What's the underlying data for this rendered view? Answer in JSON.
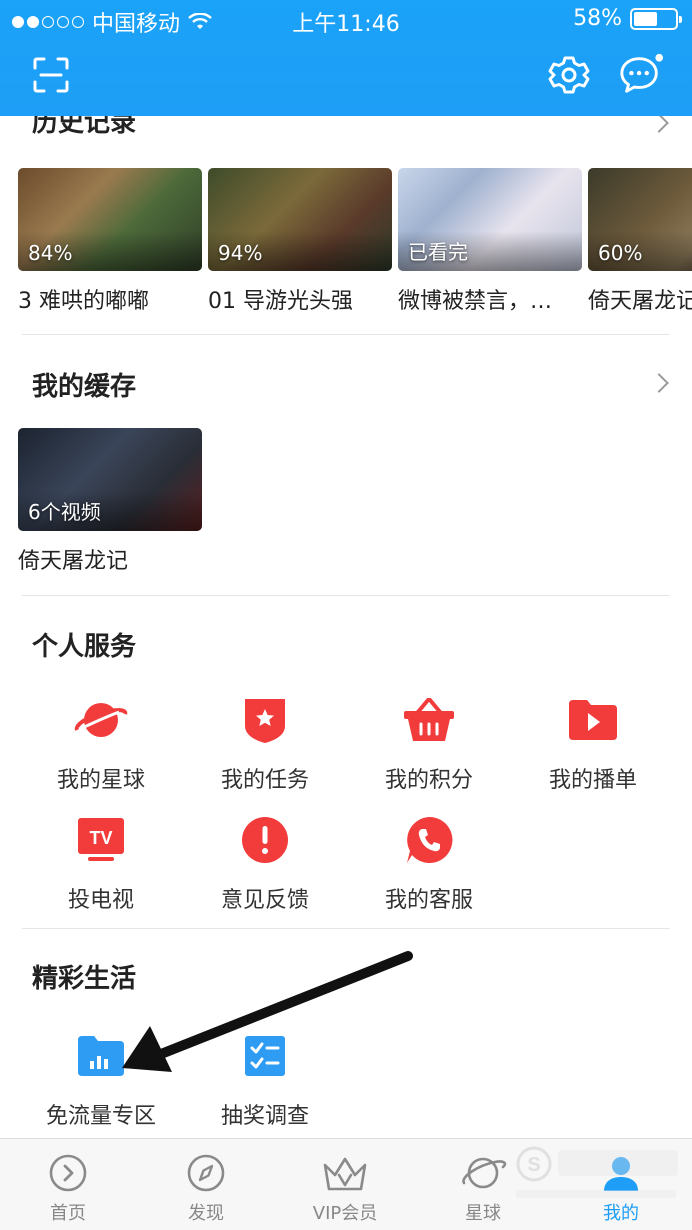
{
  "status_bar": {
    "carrier": "中国移动",
    "time": "上午11:46",
    "battery": "58%",
    "battery_level": 0.58
  },
  "header": {
    "icons": [
      "scan-icon",
      "gear-icon",
      "message-icon"
    ],
    "accent": "#1e9ef6"
  },
  "history": {
    "title": "历史记录",
    "items": [
      {
        "progress": "84%",
        "title": "3 难哄的嘟嘟"
      },
      {
        "progress": "94%",
        "title": "01 导游光头强"
      },
      {
        "progress": "已看完",
        "title": "微博被禁言，…"
      },
      {
        "progress": "60%",
        "title": "倚天屠龙记"
      }
    ]
  },
  "cache": {
    "title": "我的缓存",
    "items": [
      {
        "count": "6个视频",
        "title": "倚天屠龙记"
      }
    ]
  },
  "personal_services": {
    "title": "个人服务",
    "items": [
      {
        "label": "我的星球",
        "icon": "planet-icon"
      },
      {
        "label": "我的任务",
        "icon": "task-icon"
      },
      {
        "label": "我的积分",
        "icon": "basket-icon"
      },
      {
        "label": "我的播单",
        "icon": "playlist-icon"
      },
      {
        "label": "投电视",
        "icon": "tv-icon"
      },
      {
        "label": "意见反馈",
        "icon": "feedback-icon"
      },
      {
        "label": "我的客服",
        "icon": "phone-icon"
      }
    ],
    "icon_color": "#f23c3c"
  },
  "life": {
    "title": "精彩生活",
    "items": [
      {
        "label": "免流量专区",
        "icon": "data-folder-icon"
      },
      {
        "label": "抽奖调查",
        "icon": "checklist-icon"
      }
    ],
    "icon_color": "#2e9cf3"
  },
  "tabbar": {
    "items": [
      {
        "label": "首页",
        "icon": "home-play-icon"
      },
      {
        "label": "发现",
        "icon": "compass-icon"
      },
      {
        "label": "VIP会员",
        "icon": "crown-icon"
      },
      {
        "label": "星球",
        "icon": "planet-icon"
      },
      {
        "label": "我的",
        "icon": "user-icon",
        "active": true
      }
    ],
    "active_color": "#1e9ef6"
  }
}
